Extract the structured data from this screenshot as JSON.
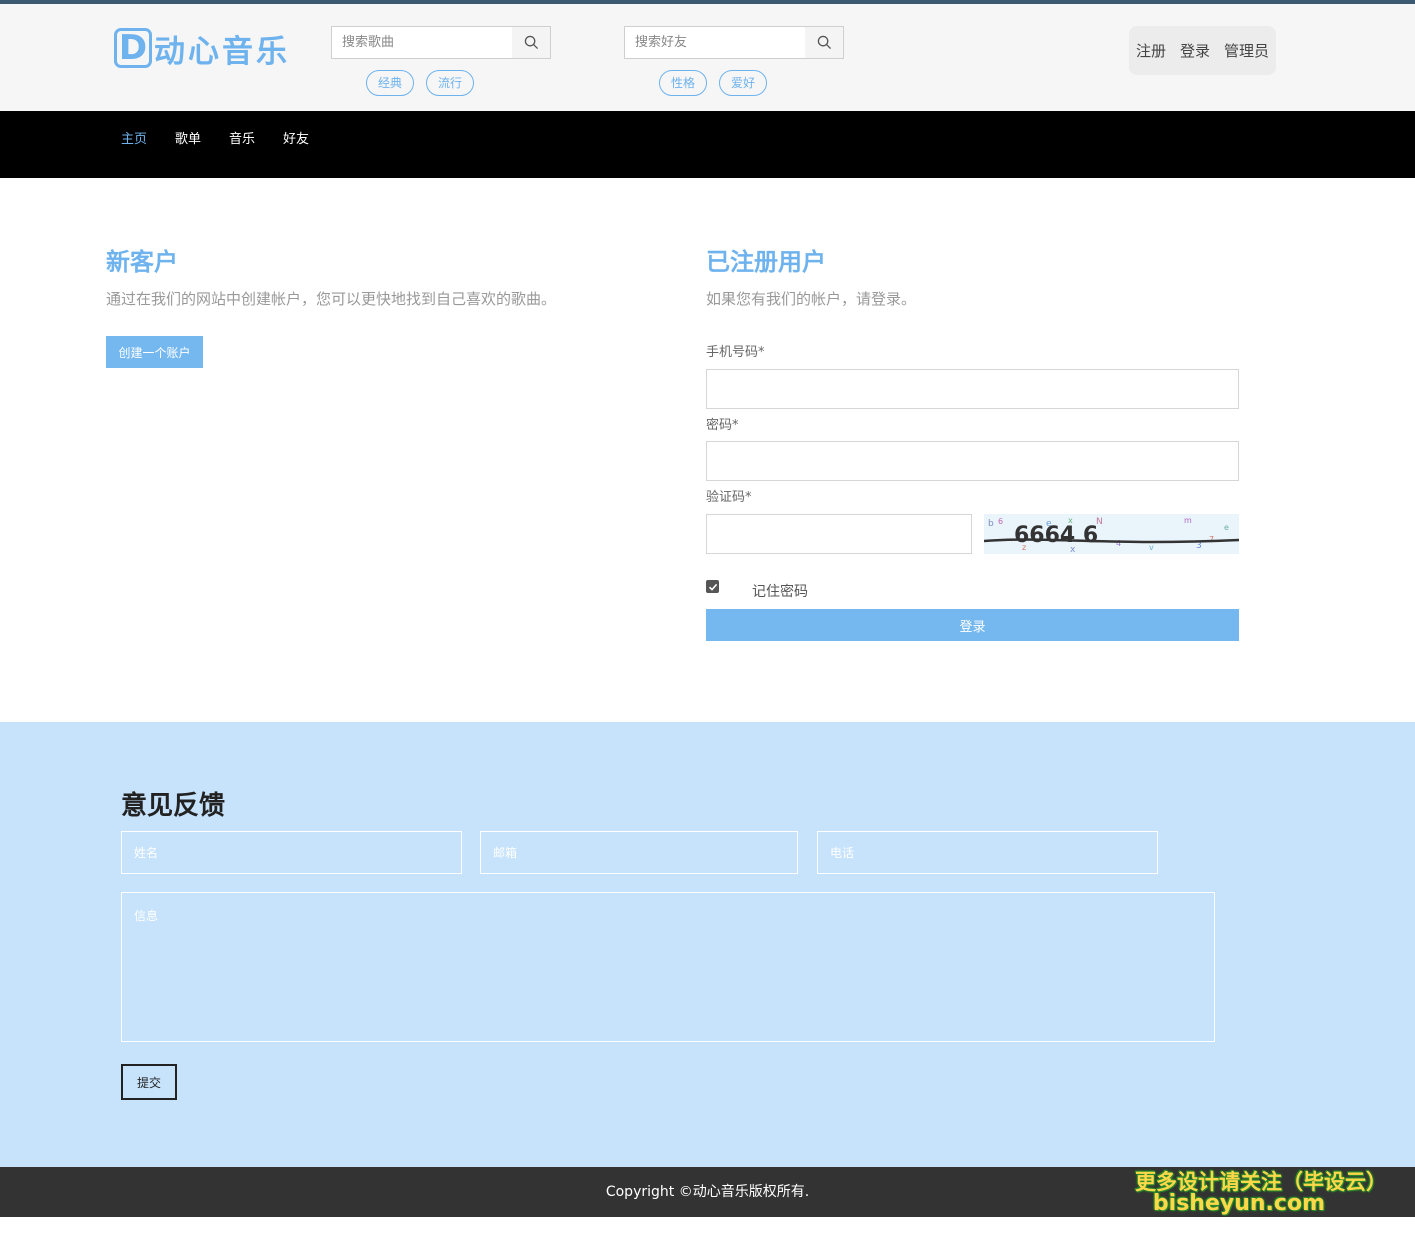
{
  "header": {
    "logo_letter": "D",
    "logo_text": "动心音乐",
    "song_search_placeholder": "搜索歌曲",
    "song_tags": [
      "经典",
      "流行"
    ],
    "friend_search_placeholder": "搜索好友",
    "friend_tags": [
      "性格",
      "爱好"
    ],
    "user_links": {
      "register": "注册",
      "login": "登录",
      "admin": "管理员"
    }
  },
  "nav": {
    "items": [
      "主页",
      "歌单",
      "音乐",
      "好友"
    ],
    "active": "主页"
  },
  "new_customer": {
    "title": "新客户",
    "desc": "通过在我们的网站中创建帐户，您可以更快地找到自己喜欢的歌曲。",
    "button": "创建一个账户"
  },
  "registered": {
    "title": "已注册用户",
    "desc": "如果您有我们的帐户，请登录。",
    "phone_label": "手机号码*",
    "password_label": "密码*",
    "captcha_label": "验证码*",
    "captcha_text": "6664 6",
    "remember_label": "记住密码",
    "remember_checked": true,
    "login_button": "登录"
  },
  "feedback": {
    "title": "意见反馈",
    "name_placeholder": "姓名",
    "email_placeholder": "邮箱",
    "phone_placeholder": "电话",
    "message_placeholder": "信息",
    "submit": "提交"
  },
  "footer": {
    "copyright": "Copyright ©动心音乐版权所有.",
    "watermark_line1": "更多设计请关注（毕设云）",
    "watermark_line2": "bisheyun.com"
  },
  "colors": {
    "accent": "#6fb3ee",
    "button": "#75b8f0",
    "nav_bg": "#000000",
    "feedback_bg": "#c7e3fc",
    "footer_bg": "#333333"
  }
}
